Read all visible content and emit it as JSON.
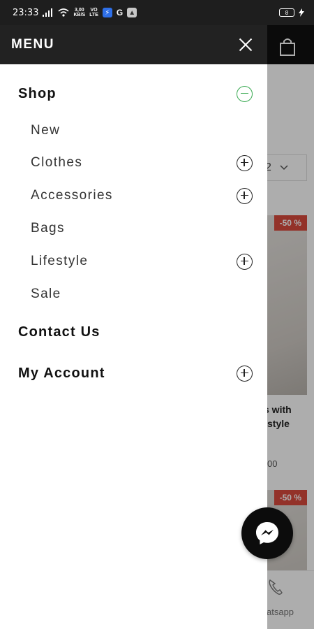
{
  "status_bar": {
    "time": "23:33",
    "net_rate_top": "3,00",
    "net_rate_bottom": "KB/S",
    "volte_top": "VO",
    "volte_bottom": "LTE",
    "app_g": "G",
    "battery": "8",
    "icons": [
      "signal-icon",
      "wifi-icon",
      "messenger-notification-icon",
      "google-icon",
      "gallery-icon",
      "battery-icon",
      "charging-icon"
    ]
  },
  "drawer": {
    "title": "MENU",
    "items": [
      {
        "label": "Shop",
        "level": "top",
        "toggle": "minus"
      },
      {
        "label": "New",
        "level": "sub",
        "toggle": "none"
      },
      {
        "label": "Clothes",
        "level": "sub",
        "toggle": "plus"
      },
      {
        "label": "Accessories",
        "level": "sub",
        "toggle": "plus"
      },
      {
        "label": "Bags",
        "level": "sub",
        "toggle": "none"
      },
      {
        "label": "Lifestyle",
        "level": "sub",
        "toggle": "plus"
      },
      {
        "label": "Sale",
        "level": "sub",
        "toggle": "none"
      },
      {
        "label": "Contact Us",
        "level": "top",
        "toggle": "none"
      },
      {
        "label": "My Account",
        "level": "top",
        "toggle": "plus"
      }
    ]
  },
  "background": {
    "sort_value": "2",
    "sale_badge_1": "-50 %",
    "sale_badge_2": "-50 %",
    "product_text_1": "s with",
    "product_text_2": "style",
    "price_fragment": "00",
    "bottom_label": "atsapp"
  },
  "colors": {
    "accent_green": "#3aaa52",
    "sale_red": "#d94a3d",
    "header_dark": "#222222"
  }
}
